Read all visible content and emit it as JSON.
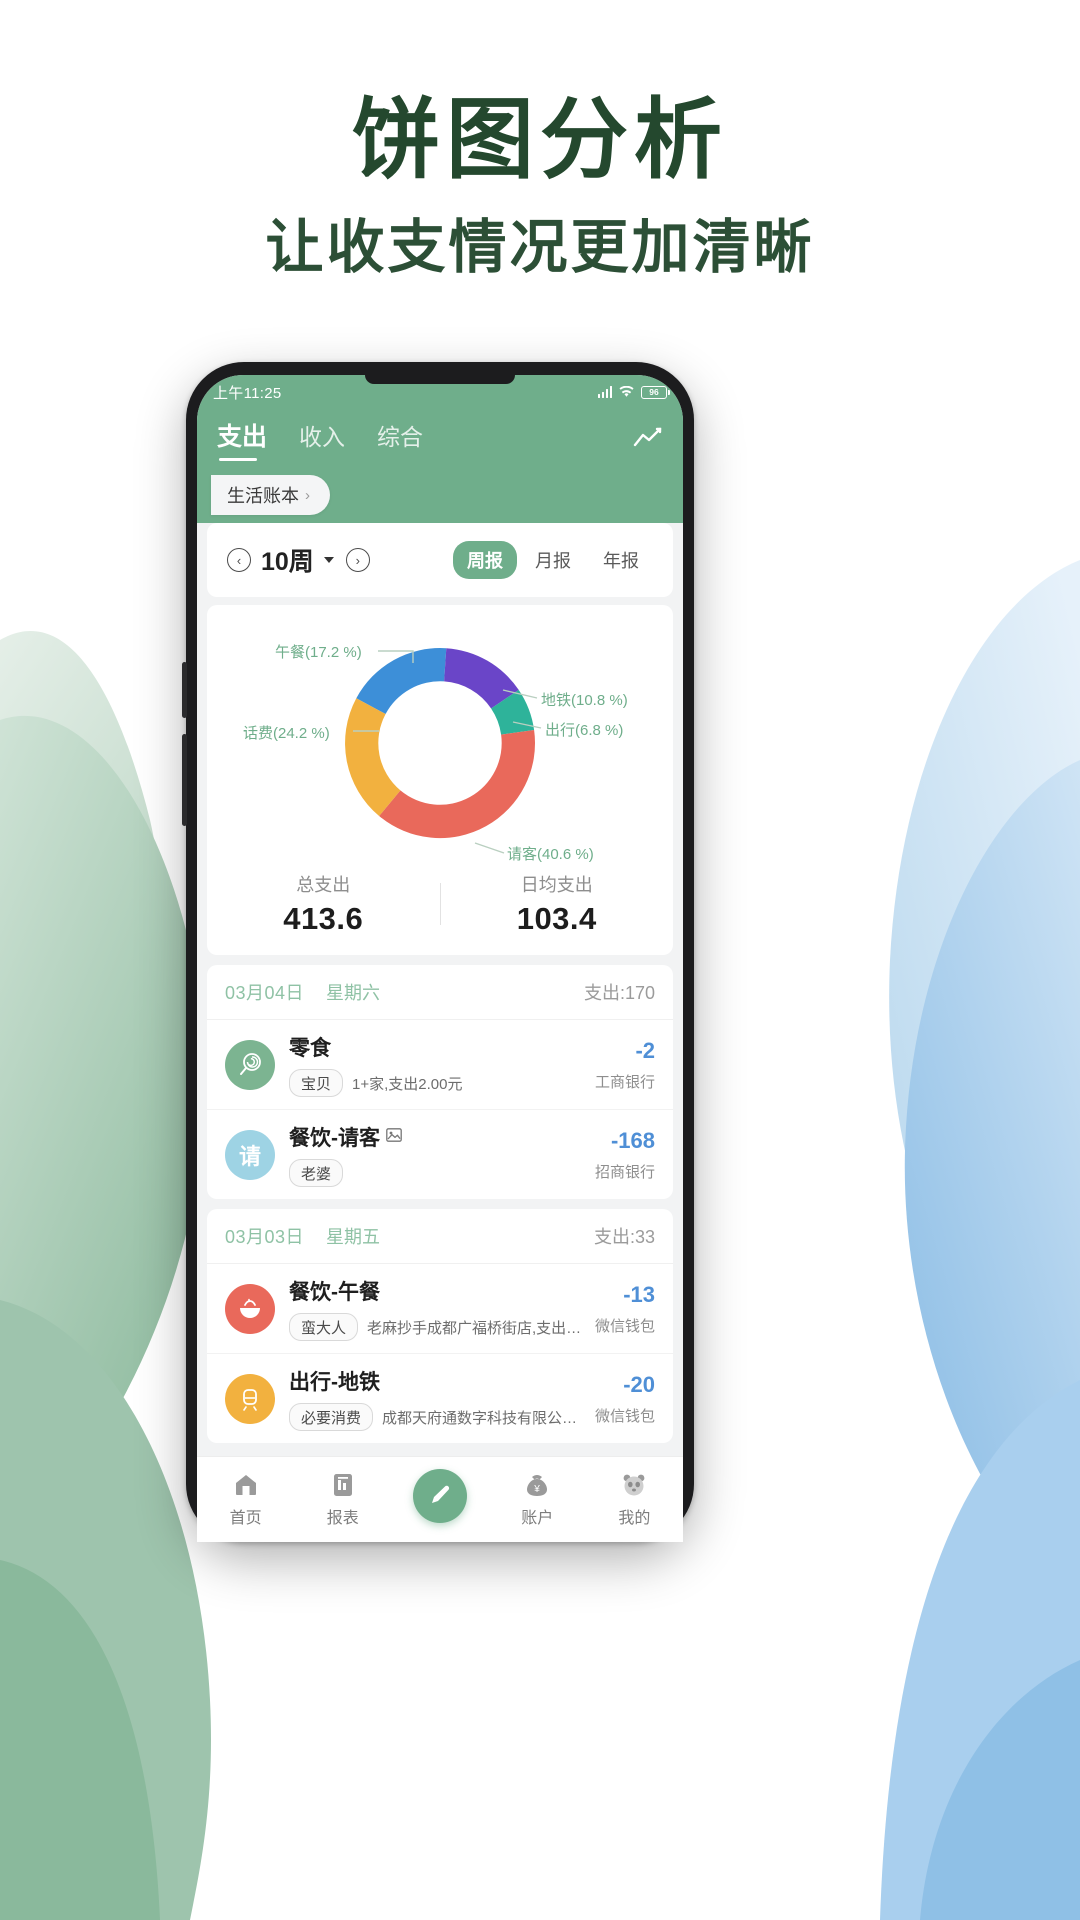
{
  "promo": {
    "title": "饼图分析",
    "subtitle": "让收支情况更加清晰",
    "title_color": "#24482e"
  },
  "statusbar": {
    "time": "上午11:25",
    "battery": "96",
    "signal_icon": "signal-icon",
    "wifi_icon": "wifi-icon",
    "battery_icon": "battery-icon"
  },
  "header": {
    "brand_color": "#6fae8b",
    "tabs": [
      {
        "label": "支出",
        "active": true
      },
      {
        "label": "收入",
        "active": false
      },
      {
        "label": "综合",
        "active": false
      }
    ],
    "trend_icon": "line-chart-icon",
    "ledger": {
      "label": "生活账本",
      "chevron": "›"
    }
  },
  "period": {
    "prev_icon": "chevron-left-icon",
    "next_icon": "chevron-right-icon",
    "label": "10周",
    "dropdown_icon": "caret-down-icon",
    "segments": [
      {
        "label": "周报",
        "active": true
      },
      {
        "label": "月报",
        "active": false
      },
      {
        "label": "年报",
        "active": false
      }
    ]
  },
  "chart_data": {
    "type": "pie",
    "title": "",
    "legend_position": "callout-labels",
    "categories": [
      "午餐",
      "地铁",
      "出行",
      "请客",
      "话费"
    ],
    "values": [
      17.2,
      10.8,
      6.8,
      40.6,
      24.2
    ],
    "labels": [
      "午餐(17.2 %)",
      "地铁(10.8 %)",
      "出行(6.8 %)",
      "请客(40.6 %)",
      "话费(24.2 %)"
    ],
    "colors": [
      "#3d8fd8",
      "#6a45c8",
      "#2eb39a",
      "#e9695b",
      "#f2b13f"
    ],
    "unit": "%",
    "donut": true
  },
  "totals": [
    {
      "key": "总支出",
      "value": "413.6"
    },
    {
      "key": "日均支出",
      "value": "103.4"
    }
  ],
  "groups": [
    {
      "date": "03月04日",
      "weekday": "星期六",
      "summary": "支出:170",
      "items": [
        {
          "avatar_text": "",
          "avatar_icon": "lollipop-icon",
          "avatar_color": "#7cb491",
          "title": "餐饮-零食",
          "title_display": "零食",
          "has_image": false,
          "tag": "宝贝",
          "note": "1+家,支出2.00元",
          "amount": "-2",
          "account": "工商银行"
        },
        {
          "avatar_text": "请",
          "avatar_icon": "",
          "avatar_color": "#9ed3e4",
          "title_display": "餐饮-请客",
          "has_image": true,
          "image_icon": "image-icon",
          "tag": "老婆",
          "note": "",
          "amount": "-168",
          "account": "招商银行"
        }
      ]
    },
    {
      "date": "03月03日",
      "weekday": "星期五",
      "summary": "支出:33",
      "items": [
        {
          "avatar_text": "",
          "avatar_icon": "bowl-icon",
          "avatar_color": "#e9695b",
          "title_display": "餐饮-午餐",
          "has_image": false,
          "tag": "蛮大人",
          "note": "老麻抄手成都广福桥街店,支出…",
          "amount": "-13",
          "account": "微信钱包"
        },
        {
          "avatar_text": "",
          "avatar_icon": "subway-icon",
          "avatar_color": "#f2b13f",
          "title_display": "出行-地铁",
          "has_image": false,
          "tag": "必要消费",
          "note": "成都天府通数字科技有限公…",
          "amount": "-20",
          "account": "微信钱包"
        }
      ]
    }
  ],
  "bottomnav": {
    "items": [
      {
        "label": "首页",
        "icon": "home-icon",
        "active": false
      },
      {
        "label": "报表",
        "icon": "report-icon",
        "active": false
      },
      {
        "label": "",
        "icon": "edit-pencil-icon",
        "active": true,
        "fab": true
      },
      {
        "label": "账户",
        "icon": "wallet-icon",
        "active": false
      },
      {
        "label": "我的",
        "icon": "panda-icon",
        "active": false
      }
    ]
  }
}
